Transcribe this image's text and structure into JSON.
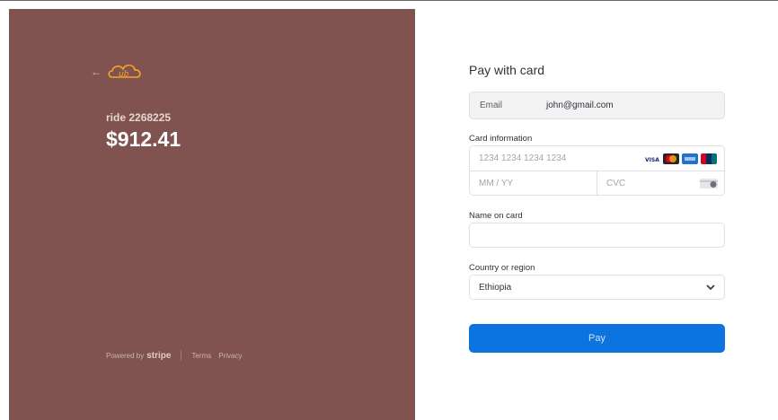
{
  "merchant": {
    "back_arrow": "←",
    "logo_text": "ub",
    "name": "ride 2268225",
    "amount": "$912.41"
  },
  "footer": {
    "powered_by": "Powered by",
    "stripe": "stripe",
    "terms": "Terms",
    "privacy": "Privacy"
  },
  "form": {
    "title": "Pay with card",
    "email_label": "Email",
    "email_value": "john@gmail.com",
    "card_info_label": "Card information",
    "card_number_placeholder": "1234 1234 1234 1234",
    "expiry_placeholder": "MM / YY",
    "cvc_placeholder": "CVC",
    "name_label": "Name on card",
    "name_value": "",
    "country_label": "Country or region",
    "country_value": "Ethiopia",
    "pay_label": "Pay"
  },
  "brands": [
    "VISA",
    "MC",
    "AMEX",
    "UnionPay"
  ],
  "colors": {
    "left_panel": "#805350",
    "logo": "#f5a623",
    "pay_button": "#0b74de"
  }
}
